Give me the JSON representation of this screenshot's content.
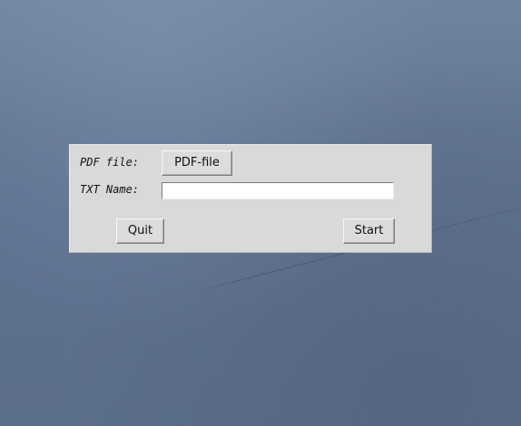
{
  "window": {
    "pdf_label": "PDF file:",
    "pdf_button_label": "PDF-file",
    "txt_label": "TXT Name:",
    "txt_value": "",
    "quit_label": "Quit",
    "start_label": "Start"
  },
  "colors": {
    "window_bg": "#d9d9d9",
    "desktop_bg": "#5f7290",
    "input_bg": "#ffffff"
  }
}
